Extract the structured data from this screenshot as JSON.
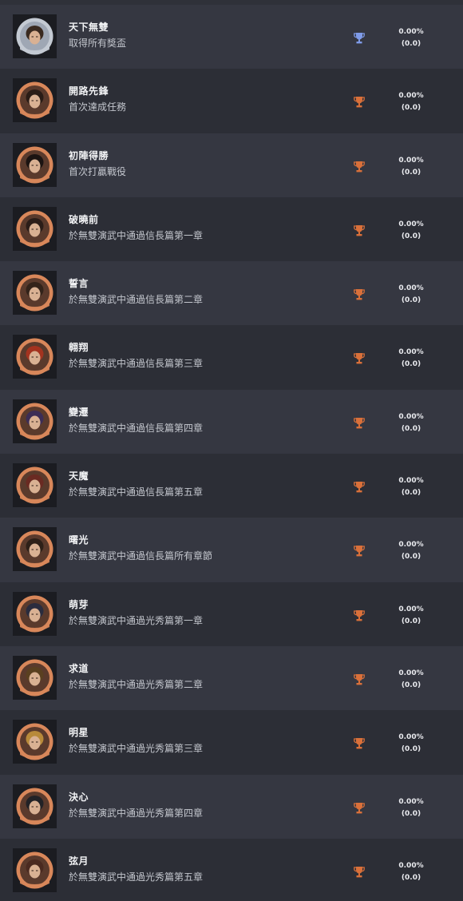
{
  "colors": {
    "platinum": "#7f9be8",
    "bronze": "#d9703a",
    "ring_bronze": "#d8875a",
    "row_odd": "#353741",
    "row_even": "#2c2e36"
  },
  "trophies": [
    {
      "title": "天下無雙",
      "description": "取得所有獎盃",
      "grade": "platinum",
      "icon": "platinum-trophy-icon",
      "percent": "0.00%",
      "count": "(0.0)"
    },
    {
      "title": "開路先鋒",
      "description": "首次達成任務",
      "grade": "bronze",
      "icon": "bronze-trophy-icon",
      "percent": "0.00%",
      "count": "(0.0)"
    },
    {
      "title": "初陣得勝",
      "description": "首次打贏戰役",
      "grade": "bronze",
      "icon": "bronze-trophy-icon",
      "percent": "0.00%",
      "count": "(0.0)"
    },
    {
      "title": "破曉前",
      "description": "於無雙演武中通過信長篇第一章",
      "grade": "bronze",
      "icon": "bronze-trophy-icon",
      "percent": "0.00%",
      "count": "(0.0)"
    },
    {
      "title": "誓言",
      "description": "於無雙演武中通過信長篇第二章",
      "grade": "bronze",
      "icon": "bronze-trophy-icon",
      "percent": "0.00%",
      "count": "(0.0)"
    },
    {
      "title": "翱翔",
      "description": "於無雙演武中通過信長篇第三章",
      "grade": "bronze",
      "icon": "bronze-trophy-icon",
      "percent": "0.00%",
      "count": "(0.0)"
    },
    {
      "title": "變遷",
      "description": "於無雙演武中通過信長篇第四章",
      "grade": "bronze",
      "icon": "bronze-trophy-icon",
      "percent": "0.00%",
      "count": "(0.0)"
    },
    {
      "title": "天魔",
      "description": "於無雙演武中通過信長篇第五章",
      "grade": "bronze",
      "icon": "bronze-trophy-icon",
      "percent": "0.00%",
      "count": "(0.0)"
    },
    {
      "title": "曙光",
      "description": "於無雙演武中通過信長篇所有章節",
      "grade": "bronze",
      "icon": "bronze-trophy-icon",
      "percent": "0.00%",
      "count": "(0.0)"
    },
    {
      "title": "萌芽",
      "description": "於無雙演武中通過光秀篇第一章",
      "grade": "bronze",
      "icon": "bronze-trophy-icon",
      "percent": "0.00%",
      "count": "(0.0)"
    },
    {
      "title": "求道",
      "description": "於無雙演武中通過光秀篇第二章",
      "grade": "bronze",
      "icon": "bronze-trophy-icon",
      "percent": "0.00%",
      "count": "(0.0)"
    },
    {
      "title": "明星",
      "description": "於無雙演武中通過光秀篇第三章",
      "grade": "bronze",
      "icon": "bronze-trophy-icon",
      "percent": "0.00%",
      "count": "(0.0)"
    },
    {
      "title": "決心",
      "description": "於無雙演武中通過光秀篇第四章",
      "grade": "bronze",
      "icon": "bronze-trophy-icon",
      "percent": "0.00%",
      "count": "(0.0)"
    },
    {
      "title": "弦月",
      "description": "於無雙演武中通過光秀篇第五章",
      "grade": "bronze",
      "icon": "bronze-trophy-icon",
      "percent": "0.00%",
      "count": "(0.0)"
    }
  ]
}
